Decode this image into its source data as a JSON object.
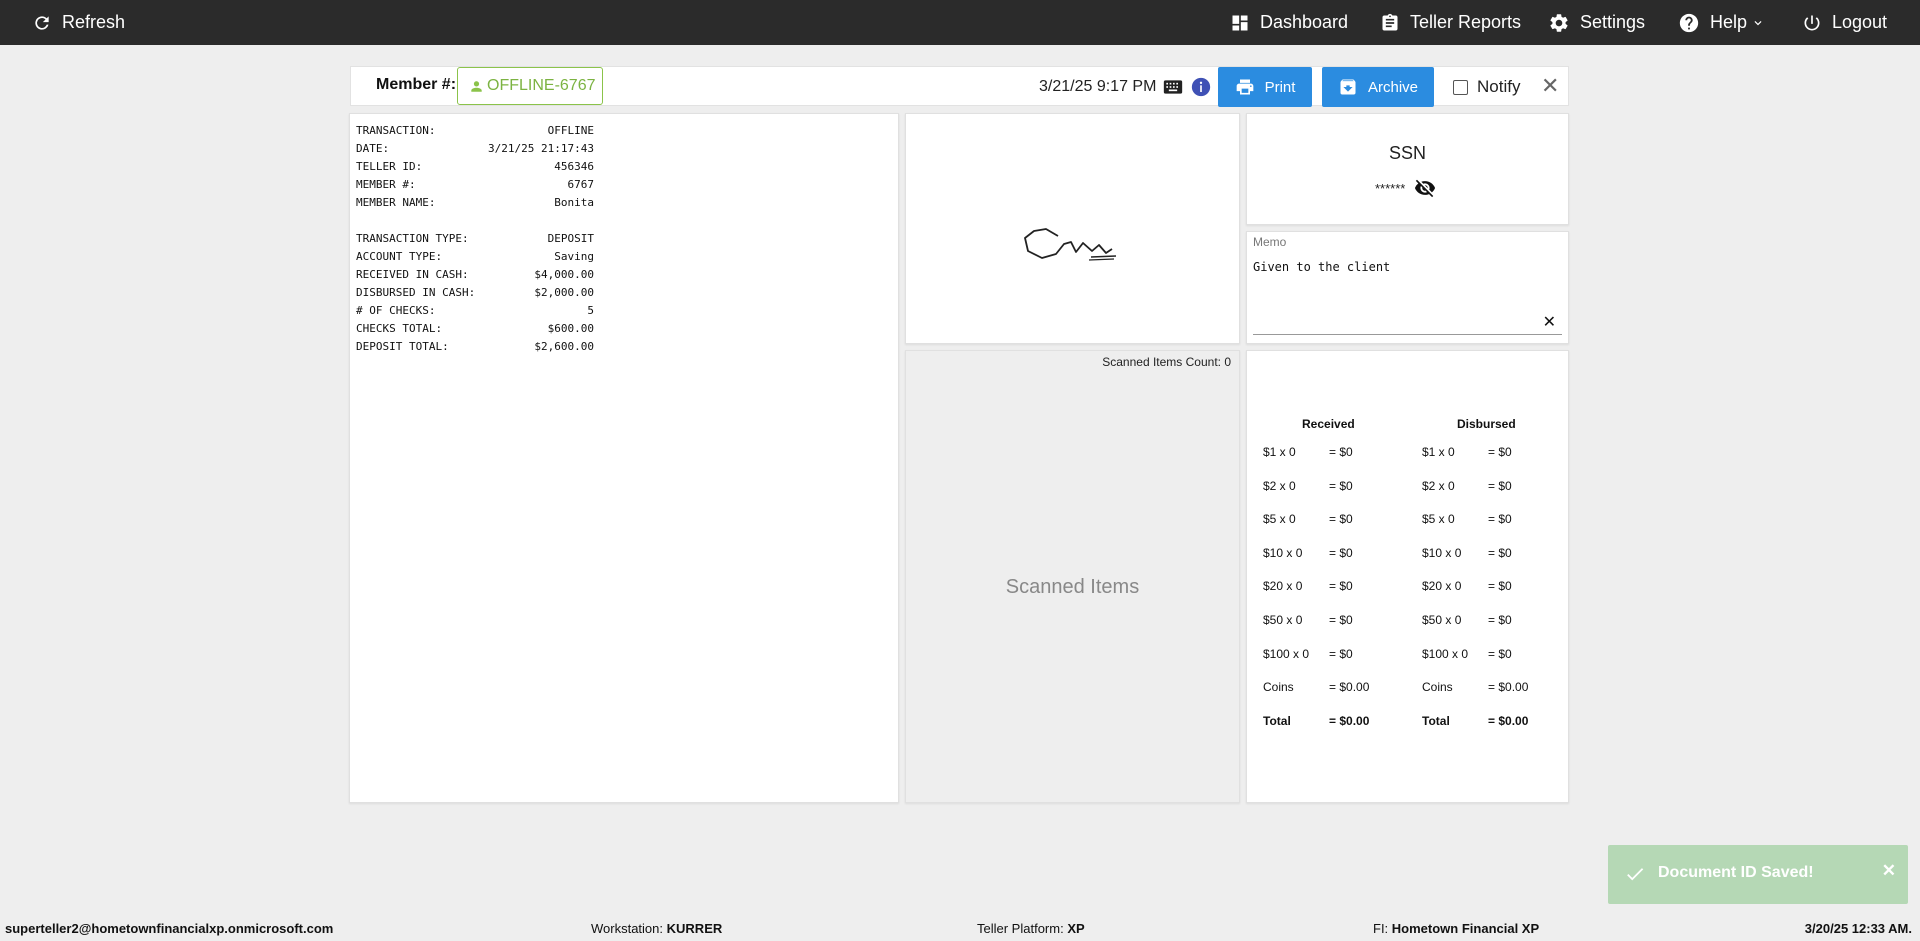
{
  "nav": {
    "refresh": "Refresh",
    "dashboard": "Dashboard",
    "teller_reports": "Teller Reports",
    "settings": "Settings",
    "help": "Help",
    "logout": "Logout"
  },
  "header": {
    "member_label": "Member #:",
    "member_value": "OFFLINE-6767",
    "datetime": "3/21/25 9:17 PM",
    "print": "Print",
    "archive": "Archive",
    "notify": "Notify",
    "close": "✕"
  },
  "receipt": {
    "lines1": [
      {
        "label": "TRANSACTION:",
        "value": "OFFLINE"
      },
      {
        "label": "DATE:",
        "value": "3/21/25 21:17:43"
      },
      {
        "label": "TELLER ID:",
        "value": "456346"
      },
      {
        "label": "MEMBER #:",
        "value": "6767"
      },
      {
        "label": "MEMBER NAME:",
        "value": "Bonita"
      }
    ],
    "lines2": [
      {
        "label": "TRANSACTION TYPE:",
        "value": "DEPOSIT"
      },
      {
        "label": "ACCOUNT TYPE:",
        "value": "Saving"
      },
      {
        "label": "RECEIVED IN CASH:",
        "value": "$4,000.00"
      },
      {
        "label": "DISBURSED IN CASH:",
        "value": "$2,000.00"
      },
      {
        "label": "# OF CHECKS:",
        "value": "5"
      },
      {
        "label": "CHECKS TOTAL:",
        "value": "$600.00"
      },
      {
        "label": "DEPOSIT TOTAL:",
        "value": "$2,600.00"
      }
    ]
  },
  "scanned": {
    "count_label": "Scanned Items Count: 0",
    "placeholder": "Scanned Items"
  },
  "ssn": {
    "title": "SSN",
    "value": "******"
  },
  "memo": {
    "label": "Memo",
    "text": "Given to the client",
    "clear": "✕"
  },
  "cash": {
    "received_header": "Received",
    "disbursed_header": "Disbursed",
    "rows": [
      {
        "r_denom": "$1 x 0",
        "r_total": "= $0",
        "d_denom": "$1 x 0",
        "d_total": "= $0"
      },
      {
        "r_denom": "$2 x 0",
        "r_total": "= $0",
        "d_denom": "$2 x 0",
        "d_total": "= $0"
      },
      {
        "r_denom": "$5 x 0",
        "r_total": "= $0",
        "d_denom": "$5 x 0",
        "d_total": "= $0"
      },
      {
        "r_denom": "$10 x 0",
        "r_total": "= $0",
        "d_denom": "$10 x 0",
        "d_total": "= $0"
      },
      {
        "r_denom": "$20 x 0",
        "r_total": "= $0",
        "d_denom": "$20 x 0",
        "d_total": "= $0"
      },
      {
        "r_denom": "$50 x 0",
        "r_total": "= $0",
        "d_denom": "$50 x 0",
        "d_total": "= $0"
      },
      {
        "r_denom": "$100 x 0",
        "r_total": "= $0",
        "d_denom": "$100 x 0",
        "d_total": "= $0"
      },
      {
        "r_denom": "Coins",
        "r_total": "= $0.00",
        "d_denom": "Coins",
        "d_total": "= $0.00"
      },
      {
        "r_denom": "Total",
        "r_total": "= $0.00",
        "d_denom": "Total",
        "d_total": "= $0.00"
      }
    ]
  },
  "toast": {
    "message": "Document ID Saved!",
    "close": "✕"
  },
  "footer": {
    "user": "superteller2@hometownfinancialxp.onmicrosoft.com",
    "workstation_label": "Workstation:",
    "workstation": "KURRER",
    "platform_label": "Teller Platform:",
    "platform": "XP",
    "fi_label": "FI:",
    "fi": "Hometown Financial XP",
    "datetime": "3/20/25 12:33 AM."
  },
  "colors": {
    "topbar": "#2b2b2b",
    "accent_blue": "#2b8ce0",
    "member_green": "#8bc34a",
    "toast_green": "#b5d8b5"
  }
}
